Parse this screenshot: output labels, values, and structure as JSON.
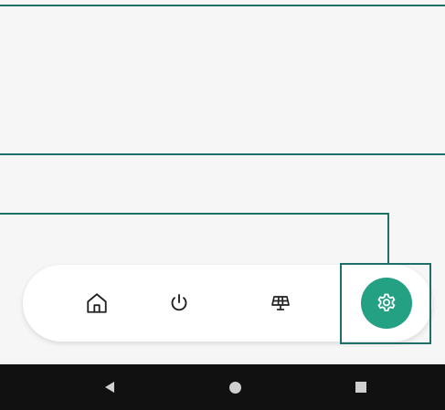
{
  "colors": {
    "background": "#f6f6f6",
    "outline": "#1c7068",
    "accent": "#24a083",
    "nav_bar_bg": "#ffffff",
    "icon": "#222222",
    "system_nav_bg": "#111111",
    "system_nav_icon": "#cfcfcf"
  },
  "bottom_nav": {
    "items": [
      {
        "id": "home",
        "icon": "home-icon",
        "selected": false
      },
      {
        "id": "power",
        "icon": "power-icon",
        "selected": false
      },
      {
        "id": "solar",
        "icon": "solar-panel-icon",
        "selected": false
      },
      {
        "id": "settings",
        "icon": "gear-icon",
        "selected": true
      }
    ]
  },
  "system_nav": {
    "buttons": [
      "back-icon",
      "home-circle-icon",
      "recents-square-icon"
    ]
  }
}
